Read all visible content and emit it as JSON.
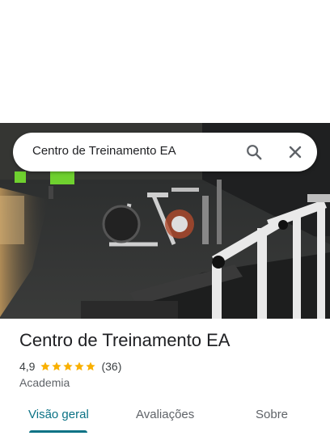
{
  "search": {
    "query": "Centro de Treinamento EA"
  },
  "icons": {
    "search": "search-icon",
    "close": "close-icon",
    "star": "star-icon"
  },
  "place": {
    "title": "Centro de Treinamento EA",
    "rating": "4,9",
    "stars": 5,
    "reviews": "(36)",
    "category": "Academia"
  },
  "tabs": [
    {
      "label": "Visão geral",
      "active": true
    },
    {
      "label": "Avaliações",
      "active": false
    },
    {
      "label": "Sobre",
      "active": false
    }
  ],
  "colors": {
    "accent": "#0b7285",
    "star": "#f9b000"
  }
}
